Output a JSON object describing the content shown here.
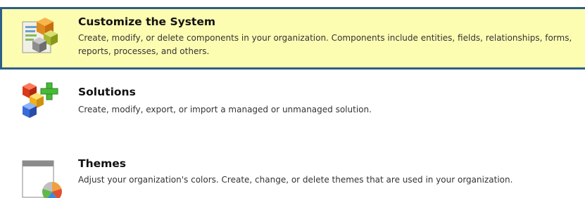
{
  "items": [
    {
      "title": "Customize the System",
      "description": "Create, modify, or delete components in your organization. Components include entities, fields, relationships, forms, reports, processes, and others.",
      "icon": "customize-system-icon",
      "highlighted": true
    },
    {
      "title": "Solutions",
      "description": "Create, modify, export, or import a managed or unmanaged solution.",
      "icon": "solutions-icon"
    },
    {
      "title": "Themes",
      "description": "Adjust your organization's colors. Create, change, or delete themes that are used in your organization.",
      "icon": "themes-icon"
    }
  ],
  "colors": {
    "highlight_background": "#fdfdb2",
    "highlight_border": "#2e5e88"
  }
}
